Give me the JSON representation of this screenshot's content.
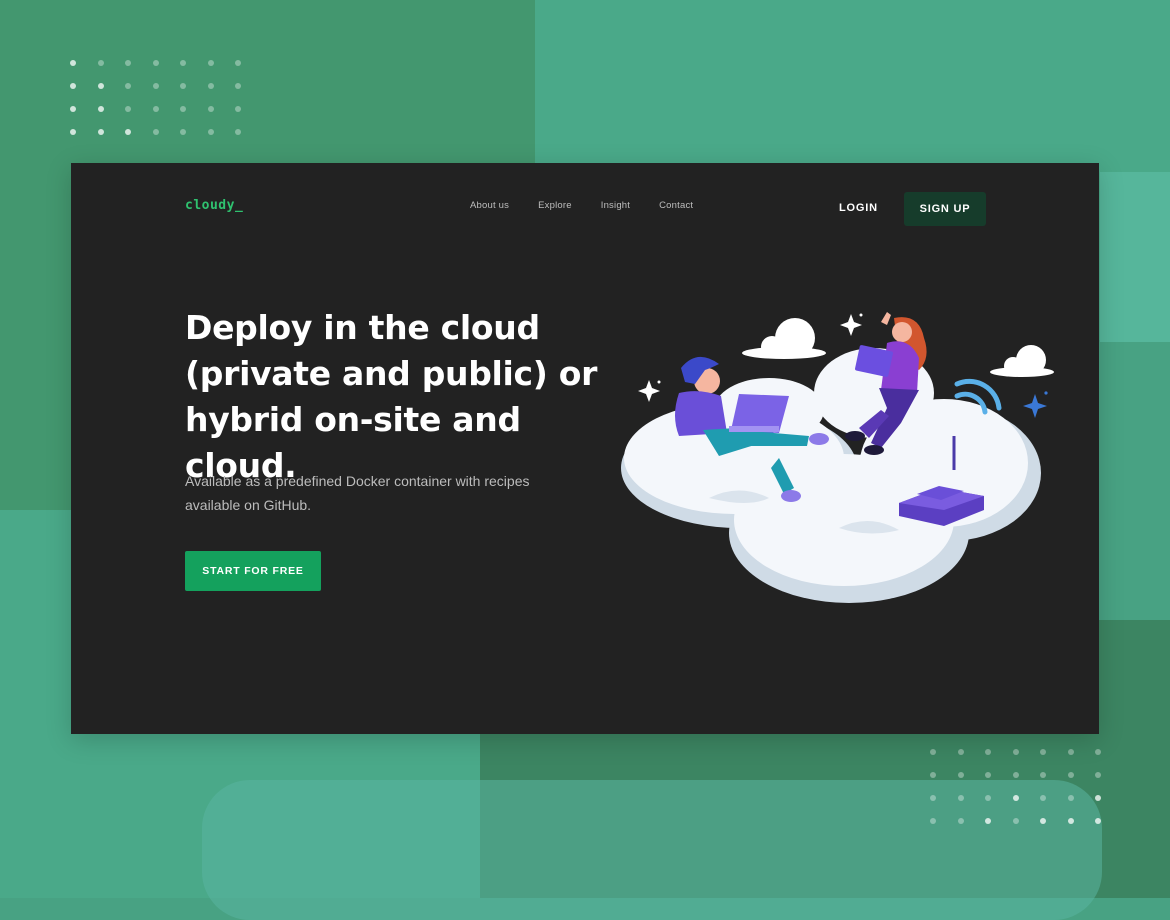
{
  "brand": {
    "logo": "cloudy_"
  },
  "nav": {
    "items": [
      {
        "label": "About us"
      },
      {
        "label": "Explore"
      },
      {
        "label": "Insight"
      },
      {
        "label": "Contact"
      }
    ],
    "login_label": "LOGIN",
    "signup_label": "SIGN UP"
  },
  "hero": {
    "headline_lines": [
      "Deploy in the cloud",
      "(private and public) or",
      "hybrid on-site and cloud."
    ],
    "subtext_lines": [
      "Available as a predefined Docker container with recipes",
      "available on GitHub."
    ],
    "cta_label": "START FOR FREE"
  },
  "colors": {
    "page_background": "#48a283",
    "frame_background": "#222222",
    "brand_green": "#2fc16f",
    "cta_green": "#14a15d",
    "signup_dark_green": "#163c2b"
  },
  "icons": [
    "people-on-cloud-illustration",
    "sparkle-icon",
    "wifi-router-icon"
  ]
}
